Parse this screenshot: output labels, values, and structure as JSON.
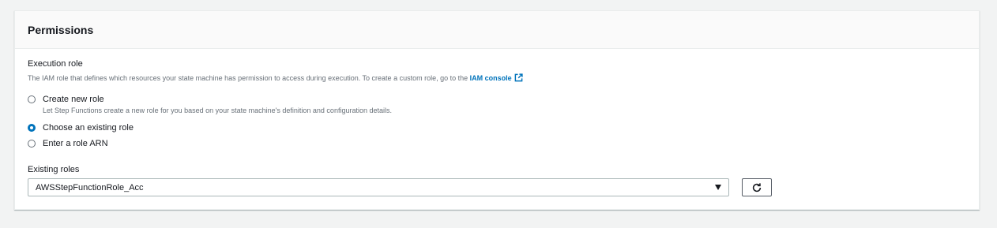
{
  "panel": {
    "title": "Permissions"
  },
  "execution_role": {
    "label": "Execution role",
    "description": "The IAM role that defines which resources your state machine has permission to access during execution. To create a custom role, go to the",
    "link_text": "IAM console",
    "options": [
      {
        "label": "Create new role",
        "description": "Let Step Functions create a new role for you based on your state machine's definition and configuration details.",
        "selected": false
      },
      {
        "label": "Choose an existing role",
        "selected": true
      },
      {
        "label": "Enter a role ARN",
        "selected": false
      }
    ]
  },
  "existing_roles": {
    "label": "Existing roles",
    "selected_value": "AWSStepFunctionRole_Acc"
  },
  "icons": {
    "external_link": "external-link-icon",
    "refresh": "refresh-icon",
    "dropdown": "caret-down-icon"
  },
  "colors": {
    "accent": "#0073bb",
    "background": "#f2f3f3"
  }
}
